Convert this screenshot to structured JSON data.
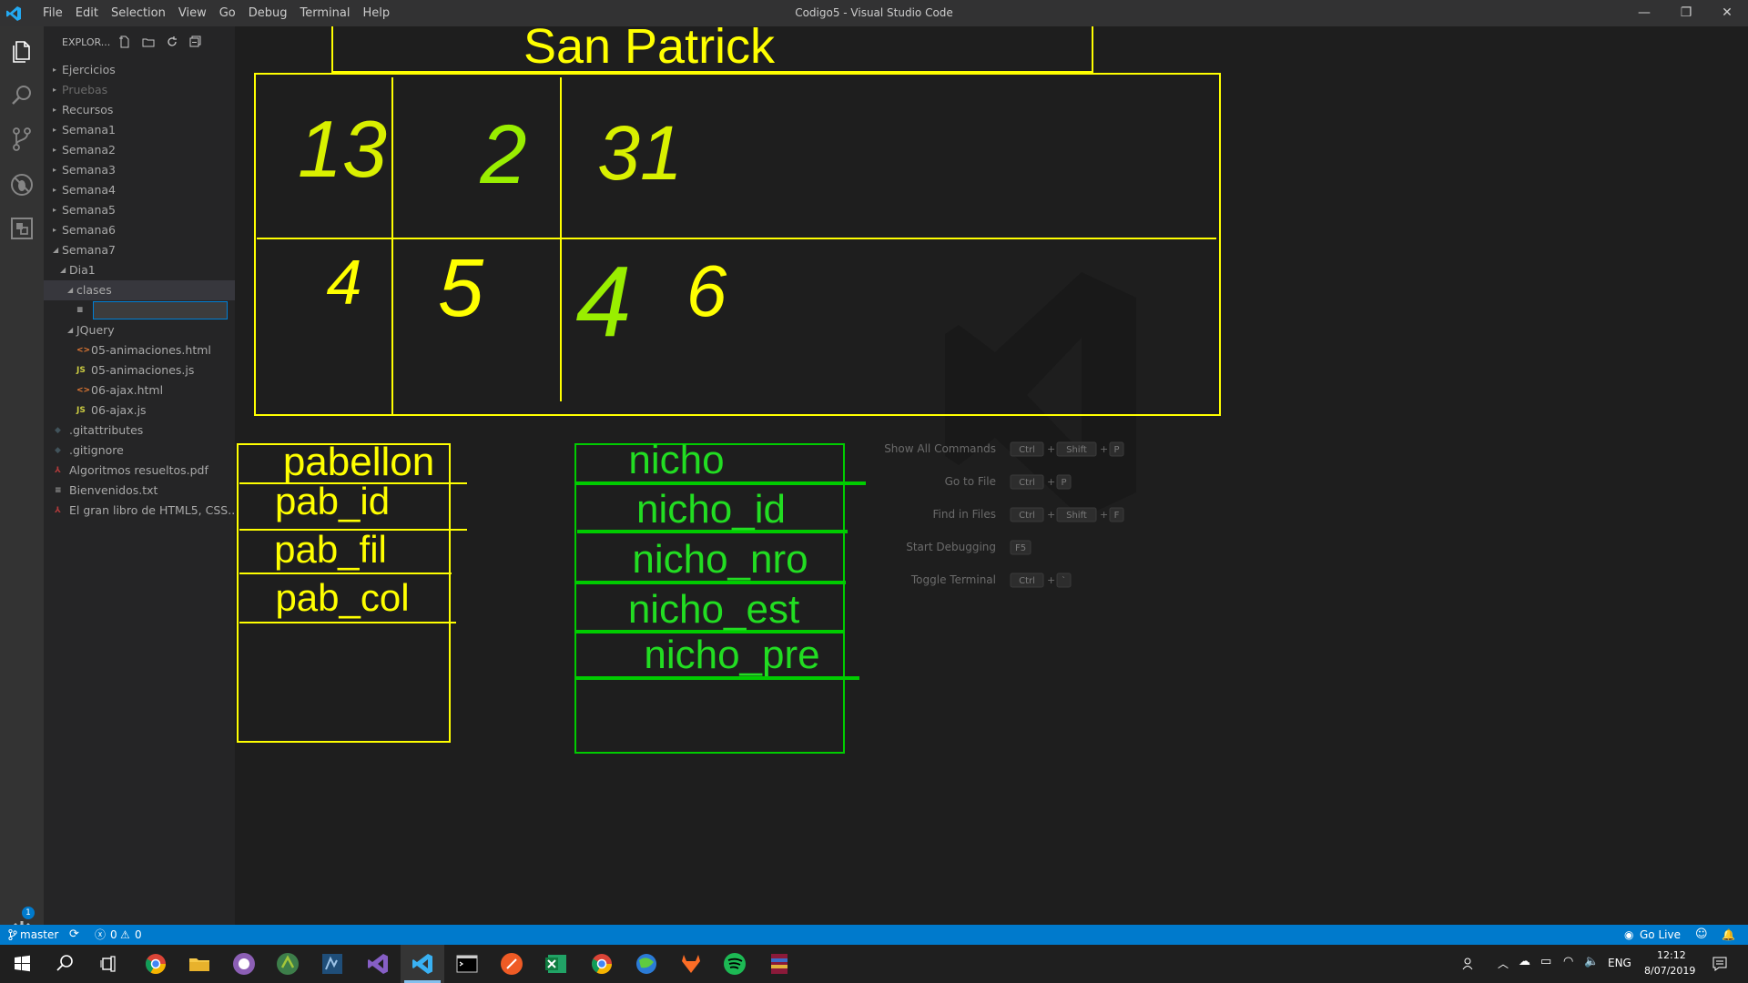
{
  "titlebar": {
    "window_title": "Codigo5 - Visual Studio Code",
    "menu": [
      "File",
      "Edit",
      "Selection",
      "View",
      "Go",
      "Debug",
      "Terminal",
      "Help"
    ],
    "minimize": "—",
    "restore": "❐",
    "close": "✕"
  },
  "sidebar": {
    "title": "EXPLOR...",
    "tree": [
      {
        "label": "Ejercicios",
        "indent": 0,
        "twisty": "right"
      },
      {
        "label": "Pruebas",
        "indent": 0,
        "twisty": "right",
        "dim": true
      },
      {
        "label": "Recursos",
        "indent": 0,
        "twisty": "right"
      },
      {
        "label": "Semana1",
        "indent": 0,
        "twisty": "right"
      },
      {
        "label": "Semana2",
        "indent": 0,
        "twisty": "right"
      },
      {
        "label": "Semana3",
        "indent": 0,
        "twisty": "right"
      },
      {
        "label": "Semana4",
        "indent": 0,
        "twisty": "right"
      },
      {
        "label": "Semana5",
        "indent": 0,
        "twisty": "right"
      },
      {
        "label": "Semana6",
        "indent": 0,
        "twisty": "right"
      },
      {
        "label": "Semana7",
        "indent": 0,
        "twisty": "down"
      },
      {
        "label": "Dia1",
        "indent": 1,
        "twisty": "down"
      },
      {
        "label": "clases",
        "indent": 2,
        "twisty": "down",
        "selected": true
      },
      {
        "label": "",
        "indent": 3,
        "edit": true
      },
      {
        "label": "JQuery",
        "indent": 2,
        "twisty": "down"
      },
      {
        "label": "05-animaciones.html",
        "indent": 3,
        "icon": "html"
      },
      {
        "label": "05-animaciones.js",
        "indent": 3,
        "icon": "js"
      },
      {
        "label": "06-ajax.html",
        "indent": 3,
        "icon": "html"
      },
      {
        "label": "06-ajax.js",
        "indent": 3,
        "icon": "js"
      },
      {
        "label": ".gitattributes",
        "indent": 0,
        "icon": "git"
      },
      {
        "label": ".gitignore",
        "indent": 0,
        "icon": "git"
      },
      {
        "label": "Algoritmos resueltos.pdf",
        "indent": 0,
        "icon": "pdf"
      },
      {
        "label": "Bienvenidos.txt",
        "indent": 0,
        "icon": "txt"
      },
      {
        "label": "El gran libro de HTML5, CSS...",
        "indent": 0,
        "icon": "pdf"
      }
    ]
  },
  "drawing": {
    "title": "San Patrick",
    "grid_top_numbers": [
      "13",
      "2",
      "31"
    ],
    "grid_bottom_numbers": [
      "4",
      "5",
      "4",
      "6"
    ],
    "pabellon": {
      "header": "pabellon",
      "fields": [
        "pab_id",
        "pab_fil",
        "pab_col"
      ]
    },
    "nicho": {
      "header": "nicho",
      "fields": [
        "nicho_id",
        "nicho_nro",
        "nicho_est",
        "nicho_pre"
      ]
    },
    "colors": {
      "yellow": "#ffff00",
      "green": "#22dd22",
      "line_green": "#00cc00"
    }
  },
  "watermark": {
    "commands": [
      {
        "label": "Show All Commands",
        "keys": [
          "Ctrl",
          "+",
          "Shift",
          "+",
          "P"
        ]
      },
      {
        "label": "Go to File",
        "keys": [
          "Ctrl",
          "+",
          "P"
        ]
      },
      {
        "label": "Find in Files",
        "keys": [
          "Ctrl",
          "+",
          "Shift",
          "+",
          "F"
        ]
      },
      {
        "label": "Start Debugging",
        "keys": [
          "F5"
        ]
      },
      {
        "label": "Toggle Terminal",
        "keys": [
          "Ctrl",
          "+",
          "`"
        ]
      }
    ]
  },
  "statusbar": {
    "branch": "master",
    "errors": "0",
    "warnings": "0",
    "go_live": "Go Live",
    "badge": "1"
  },
  "taskbar": {
    "lang": "ENG",
    "time": "12:12",
    "date": "8/07/2019"
  }
}
